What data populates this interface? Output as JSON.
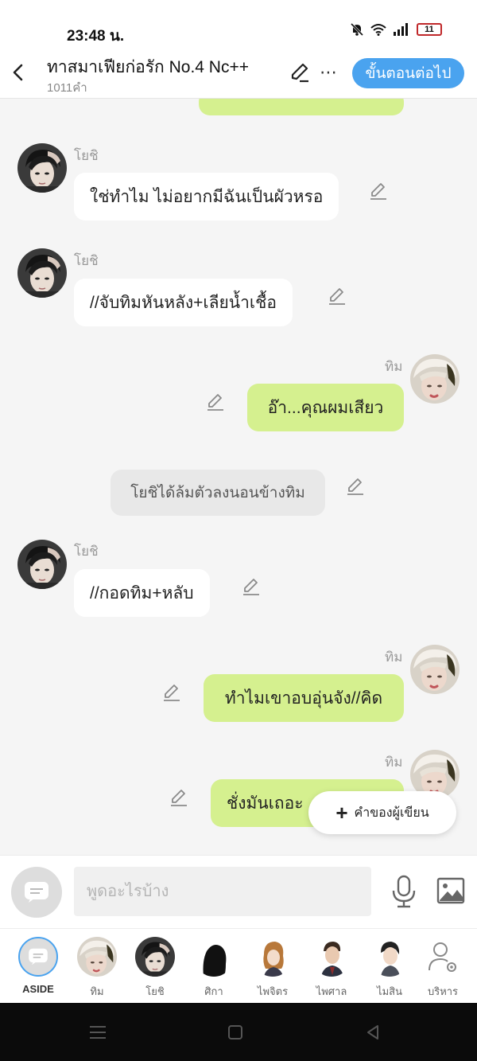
{
  "status": {
    "time": "23:48 น.",
    "battery": "11"
  },
  "header": {
    "title": "ทาสมาเฟียก่อรัก No.4 Nc++",
    "word_count": "1011คำ",
    "next_label": "ขั้นตอนต่อไป"
  },
  "messages": [
    {
      "type": "right",
      "text": ""
    },
    {
      "type": "left",
      "name": "โยชิ",
      "text": "ใช่ทำไม ไม่อยากมีฉันเป็นผัวหรอ"
    },
    {
      "type": "left",
      "name": "โยชิ",
      "text": "//จับทิมหันหลัง+เลียน้ำเชื้อ"
    },
    {
      "type": "right",
      "name": "ทิม",
      "text": "อ๊า...คุณผมเสียว"
    },
    {
      "type": "narration",
      "text": "โยชิได้ล้มตัวลงนอนข้างทิม"
    },
    {
      "type": "left",
      "name": "โยชิ",
      "text": "//กอดทิม+หลับ"
    },
    {
      "type": "right",
      "name": "ทิม",
      "text": "ทำไมเขาอบอุ่นจัง//คิด"
    },
    {
      "type": "right",
      "name": "ทิม",
      "text": "ชั่งมันเถอะ"
    }
  ],
  "fab": {
    "label": "คำของผู้เขียน"
  },
  "input": {
    "placeholder": "พูดอะไรบ้าง"
  },
  "characters": [
    {
      "label": "ASIDE"
    },
    {
      "label": "ทิม"
    },
    {
      "label": "โยชิ"
    },
    {
      "label": "ศิกา"
    },
    {
      "label": "ไพจิตร"
    },
    {
      "label": "ไพศาล"
    },
    {
      "label": "ไมสิน"
    },
    {
      "label": "บริหาร"
    }
  ],
  "colors": {
    "accent": "#4aa3ef",
    "right_bubble": "#d5f08f",
    "left_bubble": "#ffffff",
    "narration": "#e8e8e8"
  }
}
